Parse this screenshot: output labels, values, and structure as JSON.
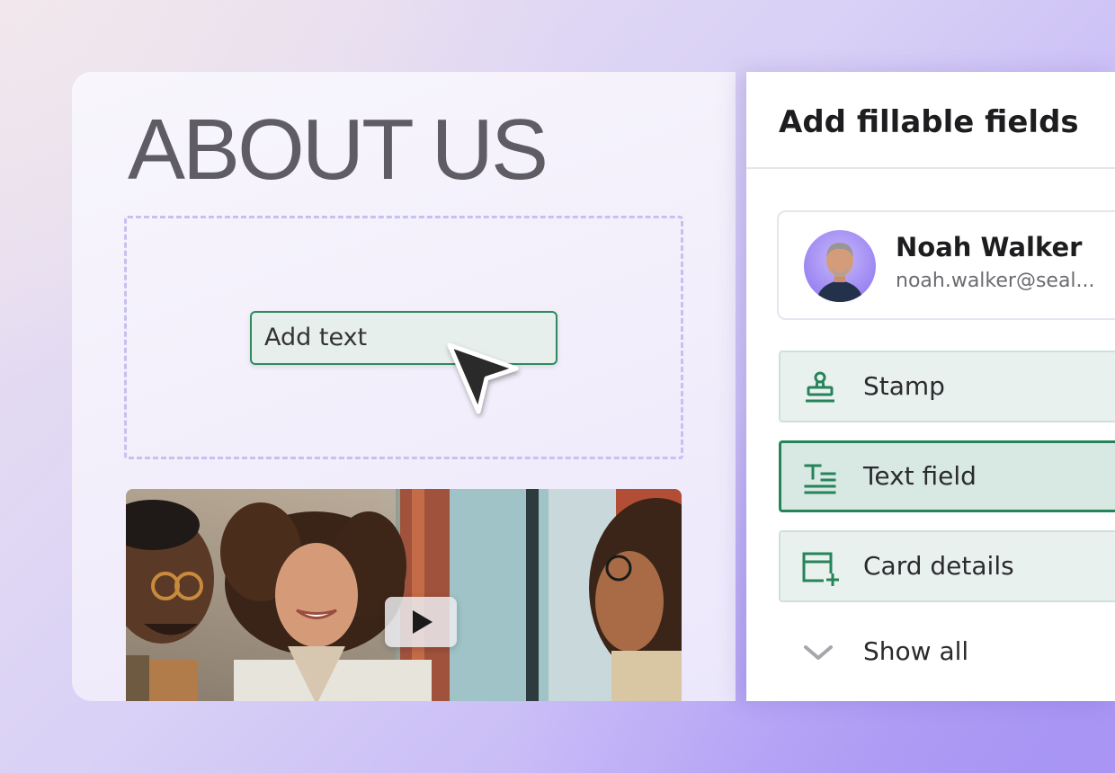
{
  "document": {
    "title": "ABOUT US",
    "text_placeholder": "Add text"
  },
  "panel": {
    "title": "Add fillable fields",
    "signer": {
      "name": "Noah Walker",
      "email": "noah.walker@seal..."
    },
    "fields": [
      {
        "label": "Stamp",
        "icon": "stamp-icon",
        "selected": false
      },
      {
        "label": "Text field",
        "icon": "text-field-icon",
        "selected": true
      },
      {
        "label": "Card details",
        "icon": "card-details-icon",
        "selected": false
      }
    ],
    "show_all_label": "Show all"
  },
  "colors": {
    "accent_green": "#26845a",
    "field_bg": "#e9f1ef",
    "dashed_border": "#c9bff0"
  }
}
